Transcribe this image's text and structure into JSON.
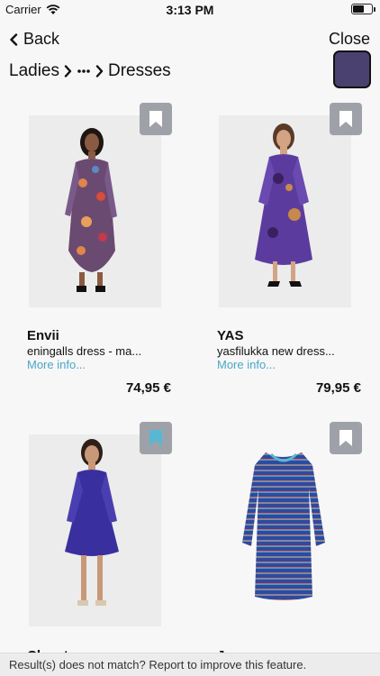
{
  "status_bar": {
    "carrier": "Carrier",
    "time": "3:13 PM",
    "battery_level": 0.6
  },
  "nav": {
    "back_label": "Back",
    "close_label": "Close"
  },
  "breadcrumb": {
    "root": "Ladies",
    "current": "Dresses"
  },
  "color_filter": {
    "color": "#4b4170"
  },
  "products": [
    {
      "brand": "Envii",
      "description": "eningalls dress - ma...",
      "more_label": "More info...",
      "price": "74,95 €",
      "saved": false
    },
    {
      "brand": "YAS",
      "description": "yasfilukka new dress...",
      "more_label": "More info...",
      "price": "79,95 €",
      "saved": false
    },
    {
      "brand": "Closet",
      "saved": true
    },
    {
      "brand": "Junarose",
      "saved": false
    }
  ],
  "colors": {
    "accent": "#4aa7c7",
    "bookmark_bg": "#9ea2a8",
    "bookmark_saved": "#5ab7d3"
  },
  "footer": {
    "text": "Result(s) does not match? Report to improve this feature."
  }
}
